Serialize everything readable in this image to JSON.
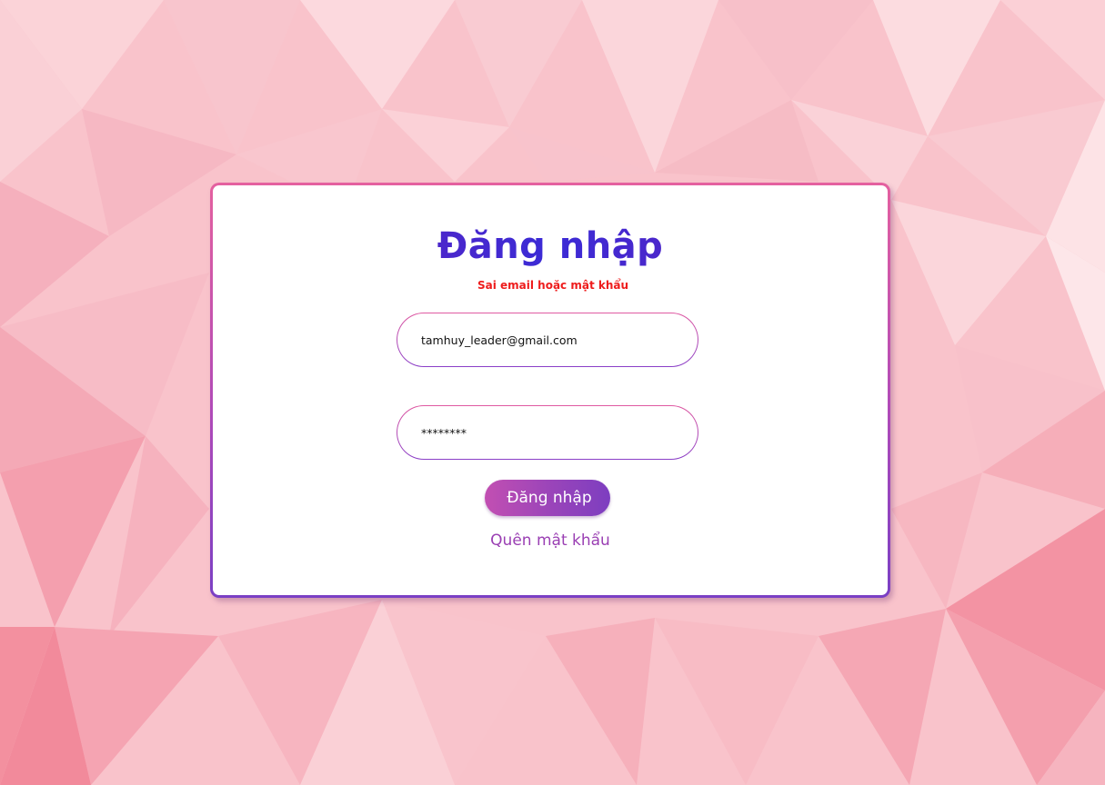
{
  "login": {
    "title": "Đăng nhập",
    "error_message": "Sai email hoặc mật khẩu",
    "email_value": "tamhuy_leader@gmail.com",
    "password_value": "********",
    "submit_label": "Đăng nhập",
    "forgot_link": "Quên mật khẩu"
  },
  "colors": {
    "title": "#4a25c8",
    "error": "#ee1c1c",
    "button_start": "#c24fb2",
    "button_end": "#7d3ec0",
    "link": "#9a3fb3",
    "background": "#f9c3cb"
  }
}
